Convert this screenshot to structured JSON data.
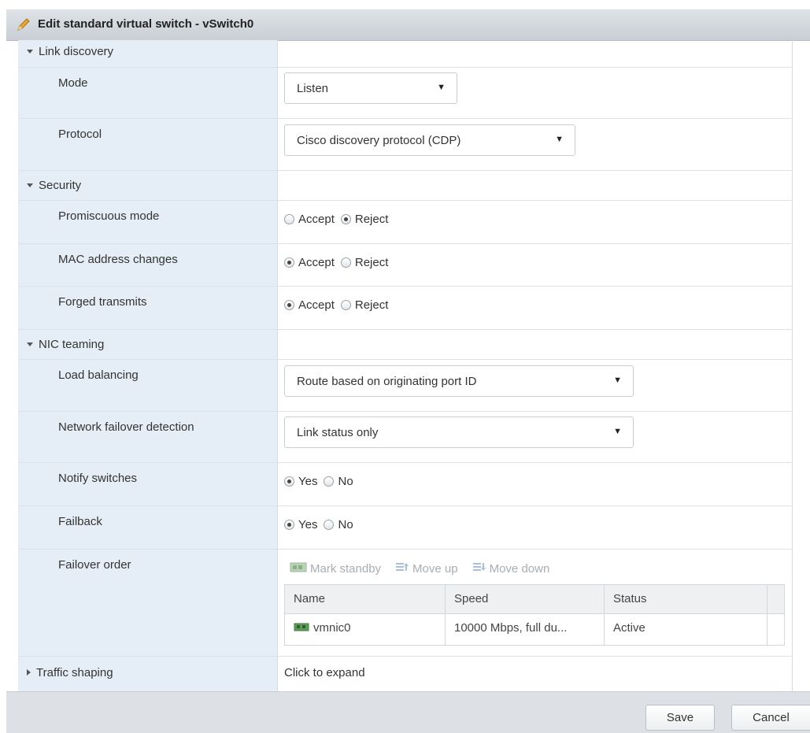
{
  "dialog": {
    "title": "Edit standard virtual switch - vSwitch0",
    "title_icon": "pencil-icon"
  },
  "link_discovery": {
    "header": "Link discovery",
    "mode": {
      "label": "Mode",
      "value": "Listen"
    },
    "protocol": {
      "label": "Protocol",
      "value": "Cisco discovery protocol (CDP)"
    }
  },
  "security": {
    "header": "Security",
    "promiscuous": {
      "label": "Promiscuous mode",
      "accept": "Accept",
      "reject": "Reject",
      "selected": "Reject"
    },
    "mac_changes": {
      "label": "MAC address changes",
      "accept": "Accept",
      "reject": "Reject",
      "selected": "Accept"
    },
    "forged": {
      "label": "Forged transmits",
      "accept": "Accept",
      "reject": "Reject",
      "selected": "Accept"
    }
  },
  "nic_teaming": {
    "header": "NIC teaming",
    "load_balancing": {
      "label": "Load balancing",
      "value": "Route based on originating port ID"
    },
    "failover_detection": {
      "label": "Network failover detection",
      "value": "Link status only"
    },
    "notify_switches": {
      "label": "Notify switches",
      "yes": "Yes",
      "no": "No",
      "selected": "Yes"
    },
    "failback": {
      "label": "Failback",
      "yes": "Yes",
      "no": "No",
      "selected": "Yes"
    },
    "failover_order": {
      "label": "Failover order",
      "toolbar": {
        "mark_standby": "Mark standby",
        "move_up": "Move up",
        "move_down": "Move down"
      },
      "columns": [
        "Name",
        "Speed",
        "Status"
      ],
      "rows": [
        {
          "name": "vmnic0",
          "speed": "10000 Mbps, full du...",
          "status": "Active"
        }
      ]
    }
  },
  "traffic_shaping": {
    "header": "Traffic shaping",
    "value": "Click to expand"
  },
  "footer": {
    "save": "Save",
    "cancel": "Cancel"
  },
  "colors": {
    "label_column": "#e5eef6",
    "titlebar": "#c8ced4",
    "footer": "#dde1e5"
  }
}
